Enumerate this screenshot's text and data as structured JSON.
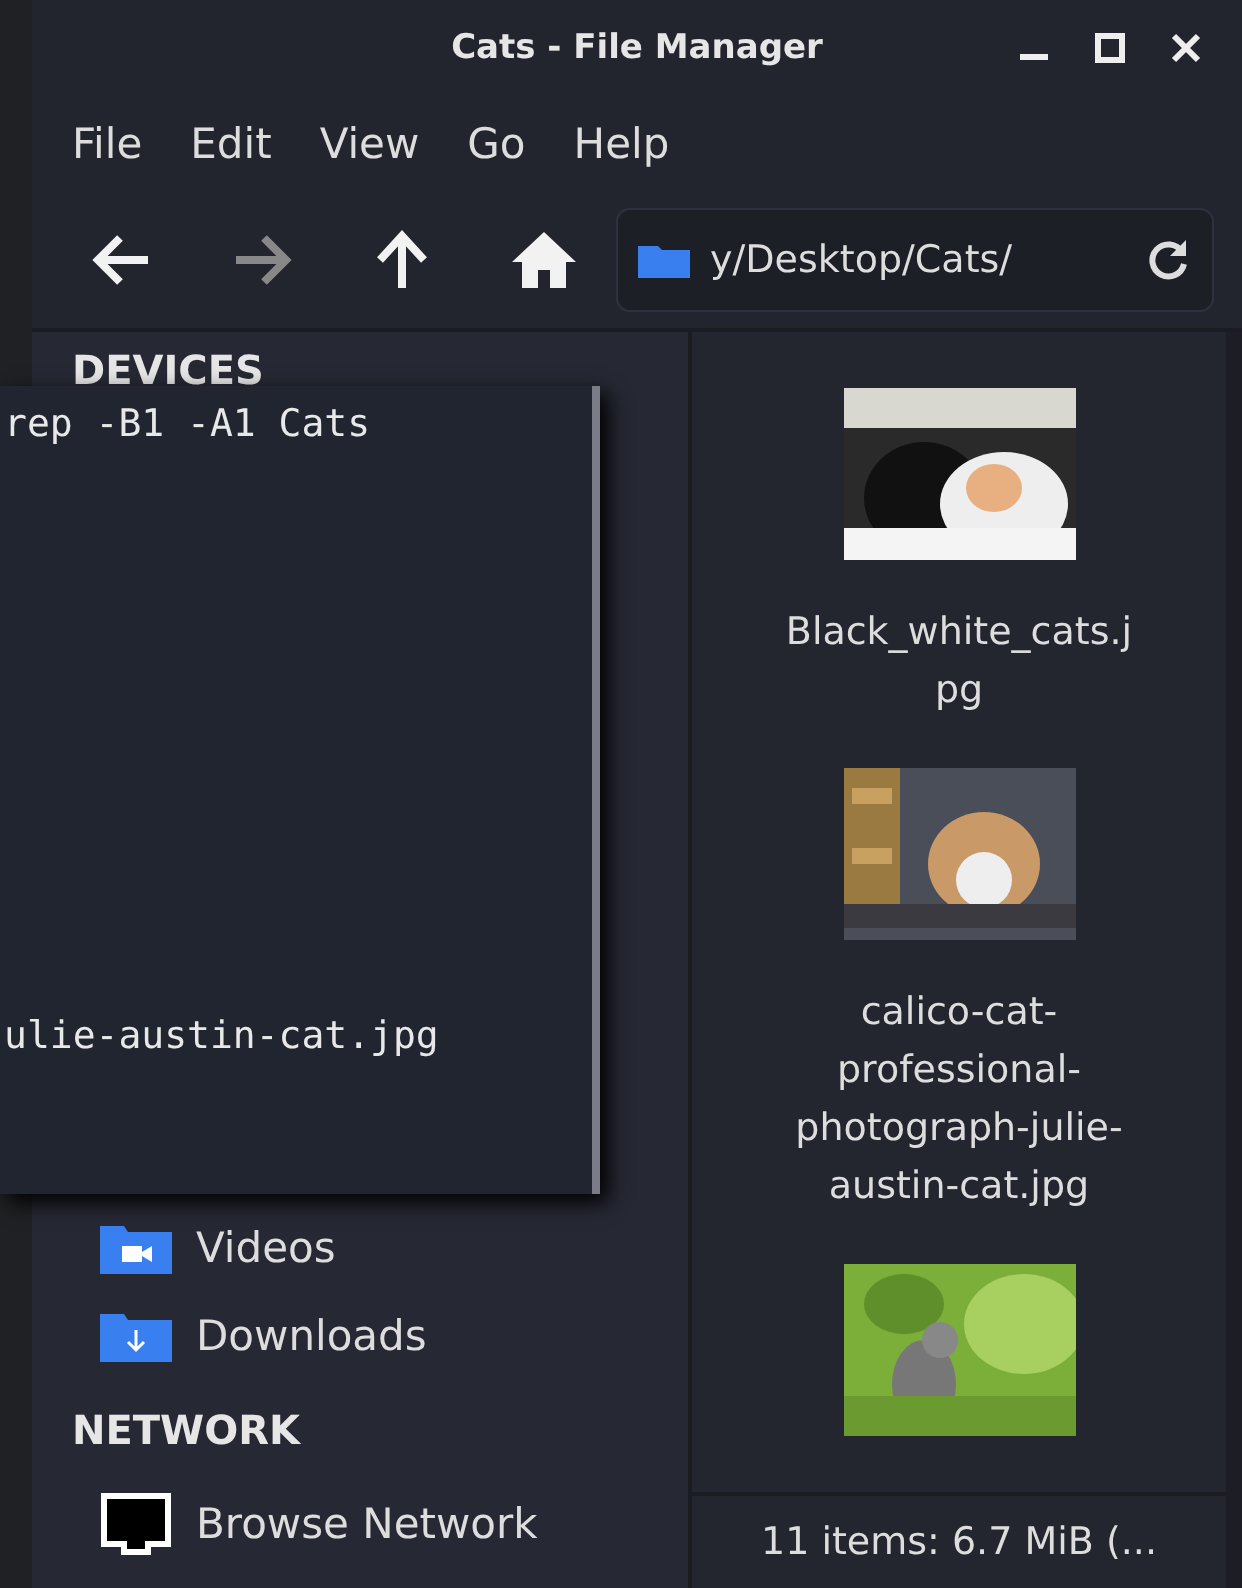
{
  "window": {
    "title": "Cats - File Manager"
  },
  "menu": [
    "File",
    "Edit",
    "View",
    "Go",
    "Help"
  ],
  "toolbar": {
    "buttons": [
      {
        "kind": "back",
        "disabled": false
      },
      {
        "kind": "forward",
        "disabled": true
      },
      {
        "kind": "up",
        "disabled": false
      },
      {
        "kind": "home",
        "disabled": false
      }
    ],
    "path": "y/Desktop/Cats/"
  },
  "sidebar": {
    "items": [
      {
        "kind": "header",
        "label": "DEVICES"
      },
      {
        "kind": "video",
        "label": "Videos"
      },
      {
        "kind": "download",
        "label": "Downloads"
      },
      {
        "kind": "header",
        "label": "NETWORK"
      },
      {
        "kind": "network",
        "label": "Browse Network"
      }
    ]
  },
  "files": [
    {
      "name": "Black_white_cats.j pg",
      "kind": "picture"
    },
    {
      "name": "calico-cat- professional- photograph-julie- austin-cat.jpg",
      "kind": "picture"
    },
    {
      "kind": "picture"
    }
  ],
  "status_bar": "11 items: 6.7 MiB (...",
  "terminal": {
    "lines": [
      "rep -B1 -A1 Cats",
      "ulie-austin-cat.jpg"
    ]
  }
}
